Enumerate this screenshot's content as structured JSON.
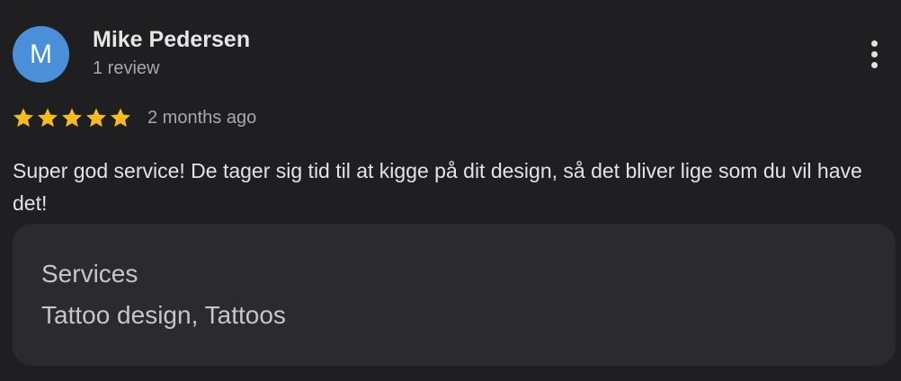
{
  "review": {
    "author": {
      "initial": "M",
      "name": "Mike Pedersen",
      "review_count": "1 review",
      "avatar_color": "#4a90d9"
    },
    "more_options_icon": "more-vert-icon",
    "rating": {
      "stars": 5,
      "max_stars": 5,
      "star_icon": "star-icon",
      "star_color": "#f6bb23"
    },
    "date": "2 months ago",
    "text": "Super god service! De tager sig tid til at kigge på dit design, så det bliver lige som du vil have det!",
    "services": {
      "label": "Services",
      "value": "Tattoo design, Tattoos"
    }
  }
}
